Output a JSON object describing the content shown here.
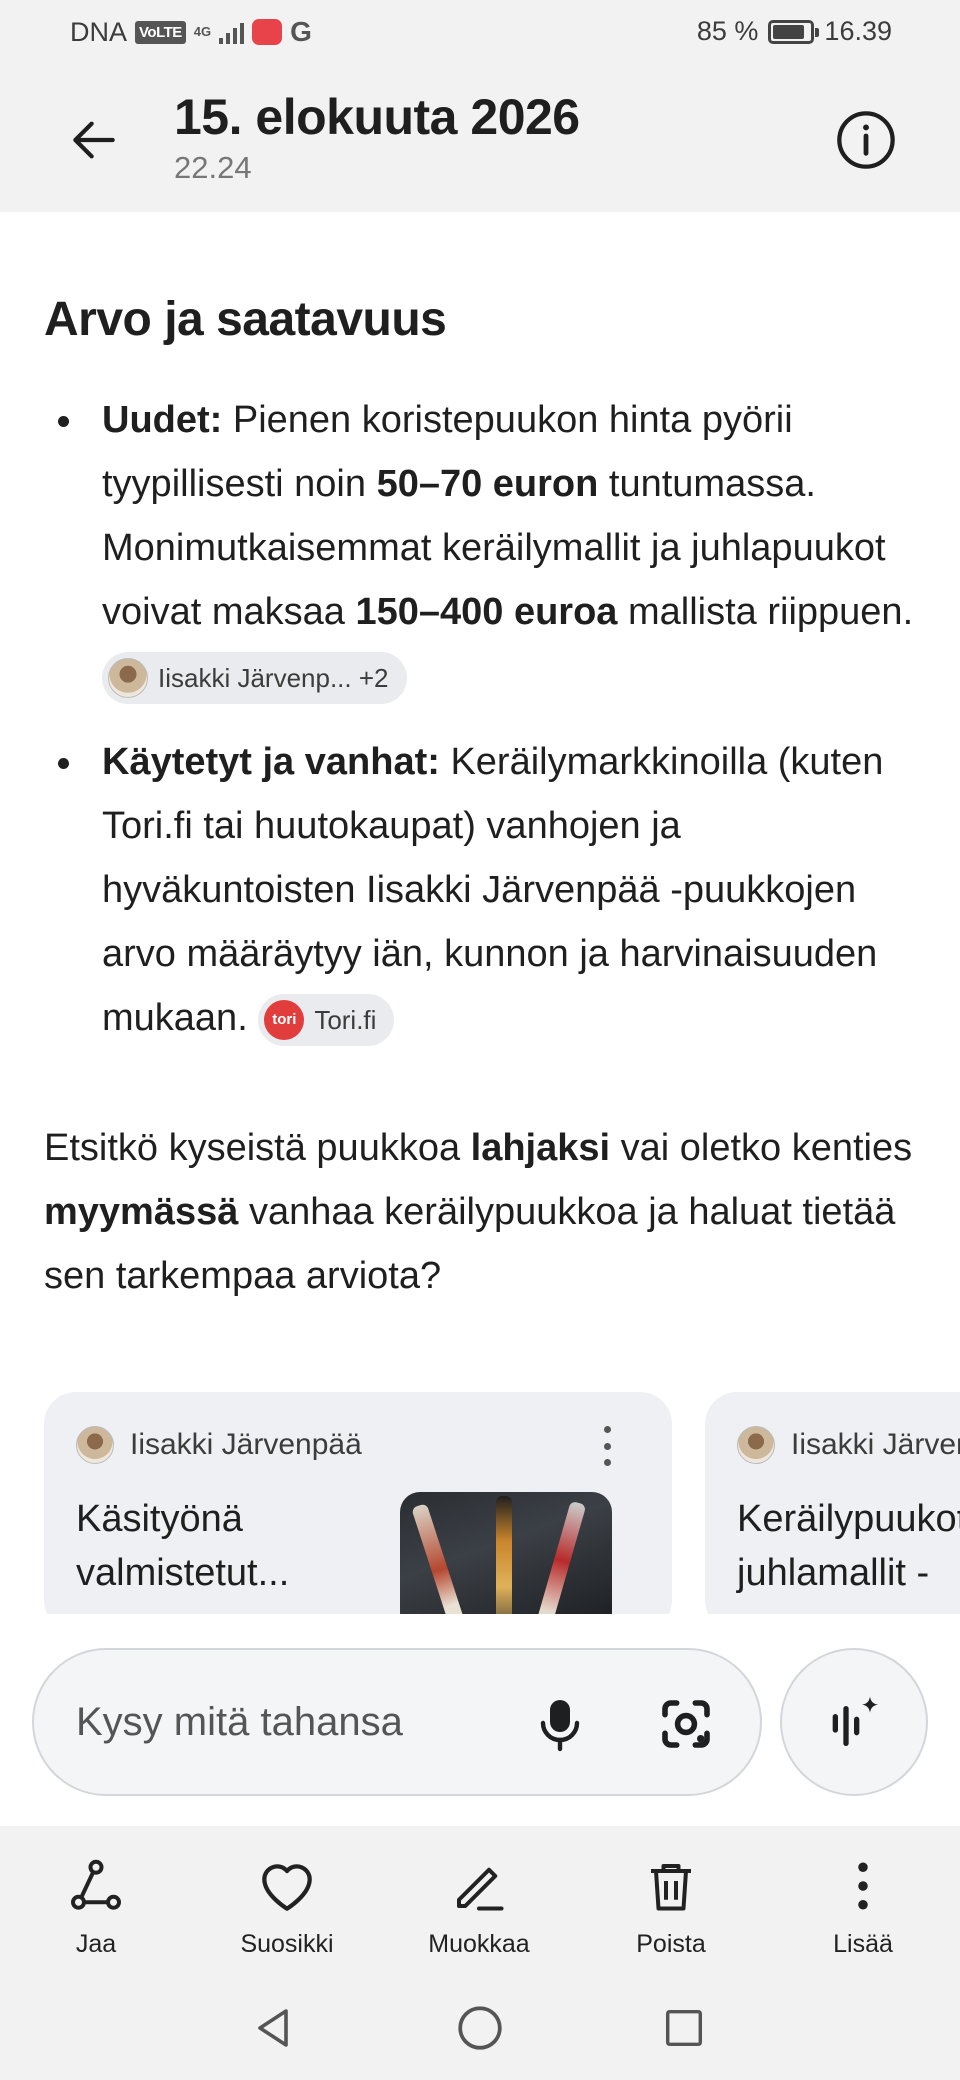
{
  "status_bar": {
    "carrier": "DNA",
    "volte": "VoLTE",
    "network": "4G",
    "battery": "85 %",
    "battery_level": 0.85,
    "time": "16.39"
  },
  "header": {
    "title": "15. elokuuta 2026",
    "subtitle": "22.24"
  },
  "content": {
    "section_title": "Arvo ja saatavuus",
    "bullets": [
      {
        "label": "Uudet:",
        "t1": " Pienen koristepuukon hinta pyörii tyypillisesti noin ",
        "b1": "50–70 euron",
        "t2": " tuntumassa. Monimutkaisemmat keräilymallit ja juhlapuukot voivat maksaa ",
        "b2": "150–400 euroa",
        "t3": " mallista riippuen. ",
        "chip": "Iisakki Järvenp... +2"
      },
      {
        "label": "Käytetyt ja vanhat:",
        "t1": " Keräilymarkkinoilla (kuten Tori.fi tai huutokaupat) vanhojen ja hyväkuntoisten Iisakki Järvenpää -puukkojen arvo määräytyy iän, kunnon ja harvinaisuuden mukaan. ",
        "chip_icon": "tori",
        "chip": "Tori.fi"
      }
    ],
    "question": {
      "t1": "Etsitkö kyseistä puukkoa ",
      "b1": "lahjaksi",
      "t2": " vai oletko kenties ",
      "b2": "myymässä",
      "t3": " vanhaa keräilypuukkoa ja haluat tietää sen tarkempaa arviota?"
    }
  },
  "cards": [
    {
      "source": "Iisakki Järvenpää",
      "title": "Käsityönä\nvalmistetut..."
    },
    {
      "source": "Iisakki Järvenpää",
      "title": "Keräilypuukot juhlamallit -"
    }
  ],
  "input": {
    "placeholder": "Kysy mitä tahansa"
  },
  "actions": {
    "share": "Jaa",
    "favorite": "Suosikki",
    "edit": "Muokkaa",
    "delete": "Poista",
    "more": "Lisää"
  },
  "icons": {
    "back": "arrow-back-icon",
    "info": "info-icon",
    "mic": "microphone-icon",
    "lens": "camera-lens-icon",
    "live": "sparkle-waveform-icon"
  },
  "colors": {
    "background": "#ffffff",
    "bar_background": "#f2f2f2",
    "chip_background": "#e9ebee",
    "tori_red": "#e23d3d",
    "app_badge_red": "#e8434a"
  }
}
